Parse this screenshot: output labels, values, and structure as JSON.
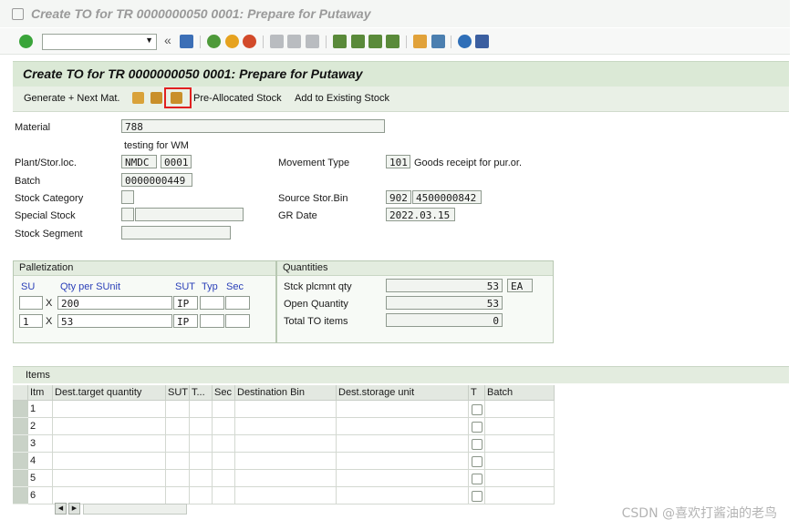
{
  "window_title": "Create TO for TR 0000000050 0001: Prepare for Putaway",
  "screen_title": "Create TO for TR 0000000050 0001: Prepare for Putaway",
  "app_toolbar": {
    "generate_next": "Generate + Next Mat.",
    "pre_allocated": "Pre-Allocated Stock",
    "add_existing": "Add to Existing Stock"
  },
  "header": {
    "material_label": "Material",
    "material_value": "788",
    "material_desc": "testing for WM",
    "plant_label": "Plant/Stor.loc.",
    "plant_value": "NMDC",
    "storloc_value": "0001",
    "batch_label": "Batch",
    "batch_value": "0000000449",
    "stock_category_label": "Stock Category",
    "special_stock_label": "Special Stock",
    "stock_segment_label": "Stock Segment",
    "movement_type_label": "Movement Type",
    "movement_type_value": "101",
    "movement_type_desc": "Goods receipt for pur.or.",
    "source_bin_label": "Source Stor.Bin",
    "source_bin_type": "902",
    "source_bin_value": "4500000842",
    "gr_date_label": "GR Date",
    "gr_date_value": "2022.03.15"
  },
  "palletization": {
    "title": "Palletization",
    "col_su": "SU",
    "col_qty": "Qty per SUnit",
    "col_sut": "SUT",
    "col_typ": "Typ",
    "col_sec": "Sec",
    "rows": [
      {
        "su": "",
        "x": "X",
        "qty": "200",
        "sut": "IP"
      },
      {
        "su": "1",
        "x": "X",
        "qty": "53",
        "sut": "IP"
      }
    ]
  },
  "quantities": {
    "title": "Quantities",
    "stck_label": "Stck plcmnt qty",
    "stck_value": "53",
    "stck_unit": "EA",
    "open_label": "Open Quantity",
    "open_value": "53",
    "total_label": "Total TO items",
    "total_value": "0"
  },
  "items": {
    "title": "Items",
    "columns": [
      "Itm",
      "Dest.target quantity",
      "SUT",
      "T...",
      "Sec",
      "Destination Bin",
      "Dest.storage unit",
      "T",
      "Batch"
    ],
    "rows": [
      "1",
      "2",
      "3",
      "4",
      "5",
      "6"
    ]
  },
  "watermark": "CSDN @喜欢打酱油的老鸟",
  "colors": {
    "highlight_box": "#e02020",
    "header_green": "#dbe9d6"
  }
}
